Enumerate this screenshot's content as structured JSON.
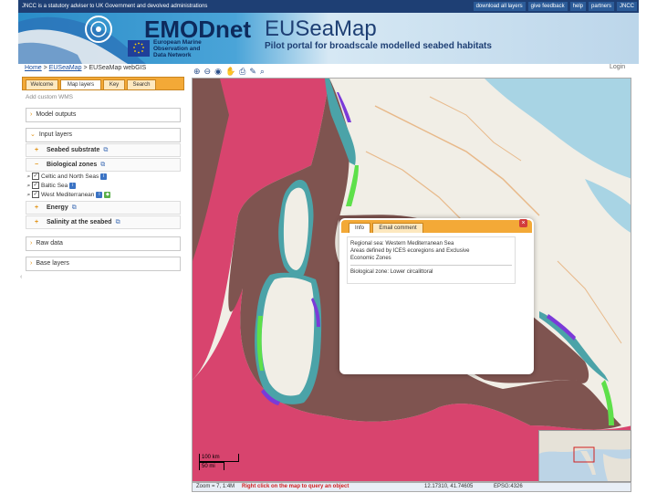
{
  "topbar": {
    "message": "JNCC is a statutory adviser to UK Government and devolved administrations",
    "links": [
      "download all layers",
      "give feedback",
      "help",
      "partners",
      "JNCC"
    ]
  },
  "header": {
    "brand": "EMODnet",
    "brand_sub": [
      "European Marine",
      "Observation and",
      "Data Network"
    ],
    "title": "EUSeaMap",
    "subtitle": "Pilot portal for broadscale modelled seabed habitats"
  },
  "breadcrumb": {
    "home": "Home",
    "sep": ">",
    "euseamap": "EUSeaMap",
    "current": "EUSeaMap webGIS"
  },
  "login": "Login",
  "tabs": [
    "Welcome",
    "Map layers",
    "Key",
    "Search"
  ],
  "left_panel": {
    "add_wms": "Add custom WMS",
    "sections": [
      {
        "label": "Model outputs"
      },
      {
        "label": "Input layers"
      }
    ],
    "input_layers": [
      {
        "label": "Seabed substrate"
      },
      {
        "label": "Biological zones"
      }
    ],
    "bio_zone_layers": [
      "Celtic and North Seas",
      "Baltic Sea",
      "West Mediterranean"
    ],
    "more_input": [
      {
        "label": "Energy"
      },
      {
        "label": "Salinity at the seabed"
      }
    ],
    "other_sections": [
      {
        "label": "Raw data"
      },
      {
        "label": "Base layers"
      }
    ]
  },
  "popup": {
    "tabs": [
      "Info",
      "Email comment"
    ],
    "text1": "Regional sea: Western Mediterranean Sea",
    "text2": "Areas defined by ICES ecoregions and Exclusive",
    "text3": "Economic Zones",
    "text4": "Biological zone: Lower circalittoral",
    "close": "×"
  },
  "scale": {
    "km": "100 km",
    "mi": "50 mi"
  },
  "status": {
    "zoom": "Zoom = 7, 1:4M",
    "hint": "Right click on the map to query an object",
    "coords": "12.17310, 41.74605",
    "epsg": "EPSG:4326"
  },
  "colors": {
    "sea_dark": "#7f5450",
    "sea_pink": "#d8446e",
    "coast_teal": "#4ba3a8",
    "coast_green": "#5ee04a",
    "coast_purple": "#7b3ad8",
    "land": "#f1eee6",
    "lake": "#a8d4e4",
    "accent_orange": "#f3a937",
    "header_navy": "#1e3f74"
  }
}
